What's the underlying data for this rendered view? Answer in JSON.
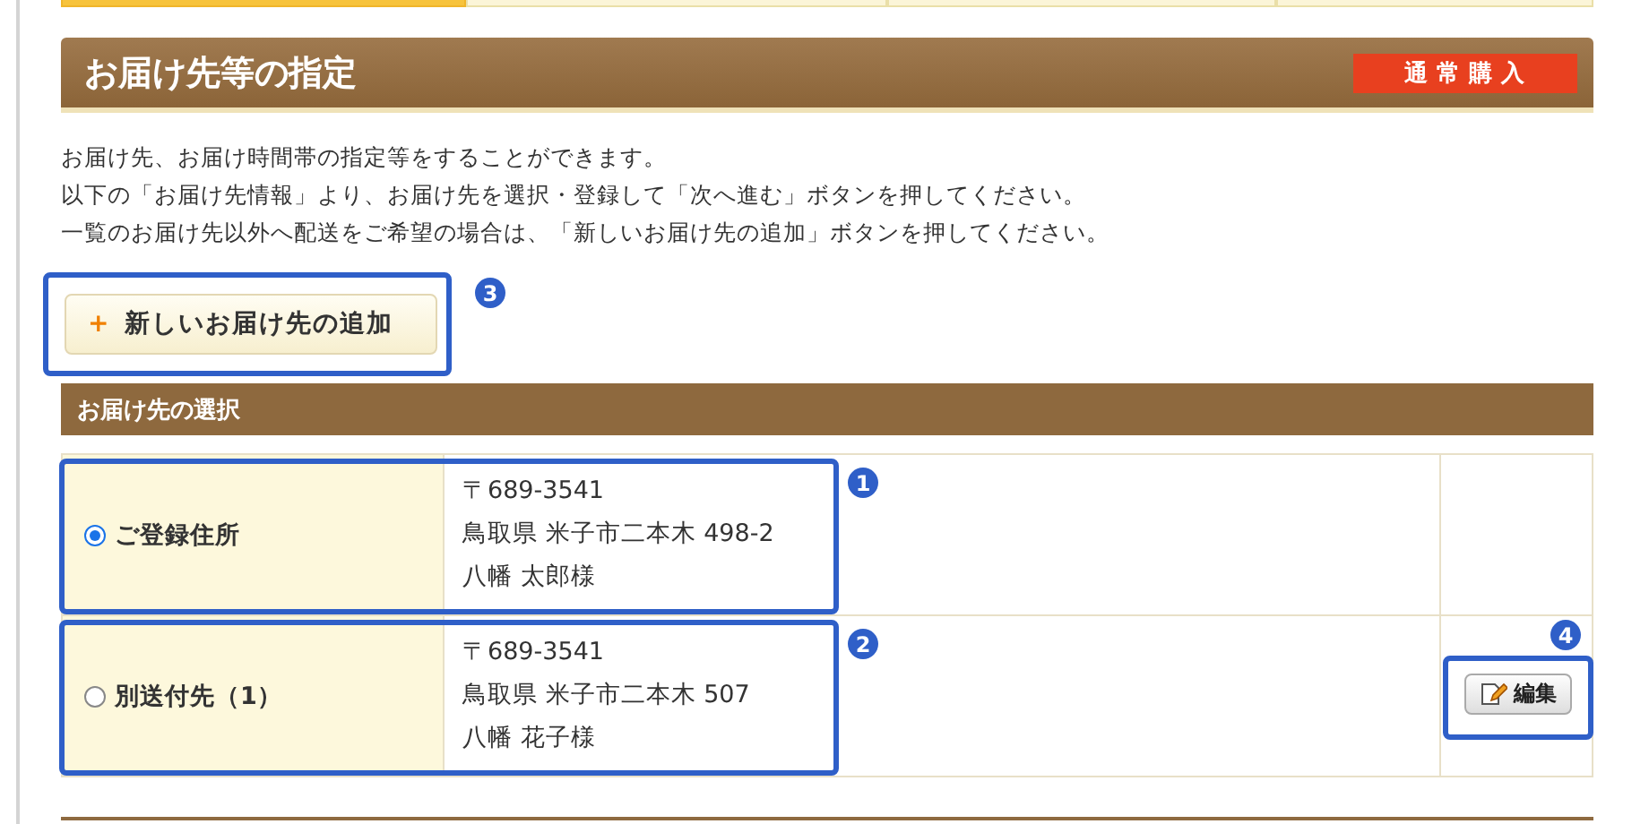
{
  "steps": [
    {
      "selected": true
    },
    {
      "selected": false
    },
    {
      "selected": false
    },
    {
      "selected": false
    }
  ],
  "header": {
    "title": "お届け先等の指定",
    "badge": "通常購入"
  },
  "intro": [
    "お届け先、お届け時間帯の指定等をすることができます。",
    "以下の「お届け先情報」より、お届け先を選択・登録して「次へ進む」ボタンを押してください。",
    "一覧のお届け先以外へ配送をご希望の場合は、「新しいお届け先の追加」ボタンを押してください。"
  ],
  "add_button": {
    "icon": "+",
    "label": "新しいお届け先の追加",
    "callout": "3"
  },
  "section": {
    "title": "お届け先の選択"
  },
  "addresses": [
    {
      "label": "ご登録住所",
      "selected": true,
      "postal": "〒689-3541",
      "address": "鳥取県 米子市二本木 498-2",
      "name": "八幡 太郎様",
      "callout": "1"
    },
    {
      "label": "別送付先（1）",
      "selected": false,
      "postal": "〒689-3541",
      "address": "鳥取県 米子市二本木 507",
      "name": "八幡 花子様",
      "callout": "2",
      "edit_button": {
        "label": "編集",
        "callout": "4"
      }
    }
  ]
}
